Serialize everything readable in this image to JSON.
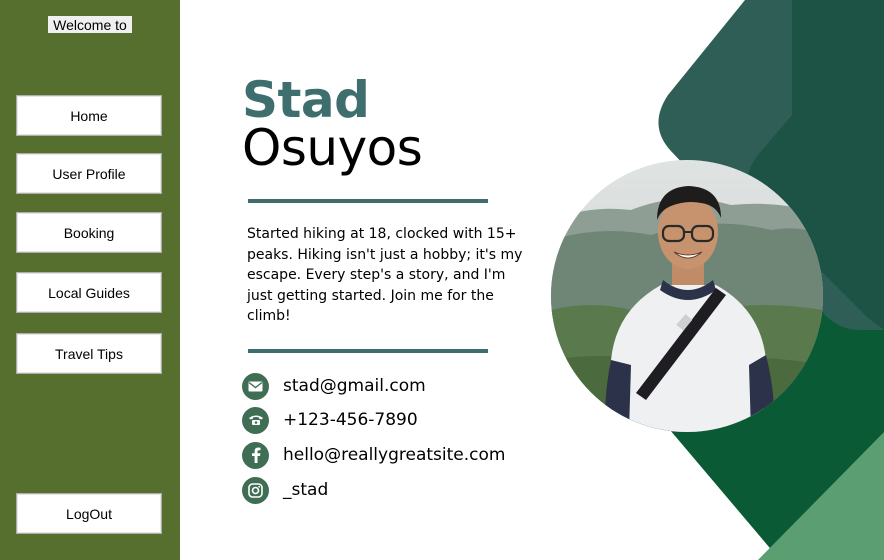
{
  "sidebar": {
    "welcome": "Welcome to",
    "items": [
      {
        "label": "Home"
      },
      {
        "label": "User Profile"
      },
      {
        "label": "Booking"
      },
      {
        "label": "Local Guides"
      },
      {
        "label": "Travel Tips"
      }
    ],
    "logout": "LogOut"
  },
  "profile": {
    "first_name": "Stad",
    "last_name": "Osuyos",
    "bio": "Started hiking at 18, clocked with 15+ peaks. Hiking isn't just a hobby; it's my escape. Every step's a story, and I'm just getting started. Join me for the climb!",
    "contacts": [
      {
        "icon": "email-icon",
        "text": "stad@gmail.com"
      },
      {
        "icon": "phone-icon",
        "text": "+123-456-7890"
      },
      {
        "icon": "facebook-icon",
        "text": "hello@reallygreatsite.com"
      },
      {
        "icon": "instagram-icon",
        "text": "_stad"
      }
    ]
  },
  "colors": {
    "sidebar": "#566e2e",
    "accent": "#3f6e6e",
    "dark_green": "#0b5a36",
    "teal_dark": "#2c5a52",
    "light_green": "#5a9e6e"
  }
}
